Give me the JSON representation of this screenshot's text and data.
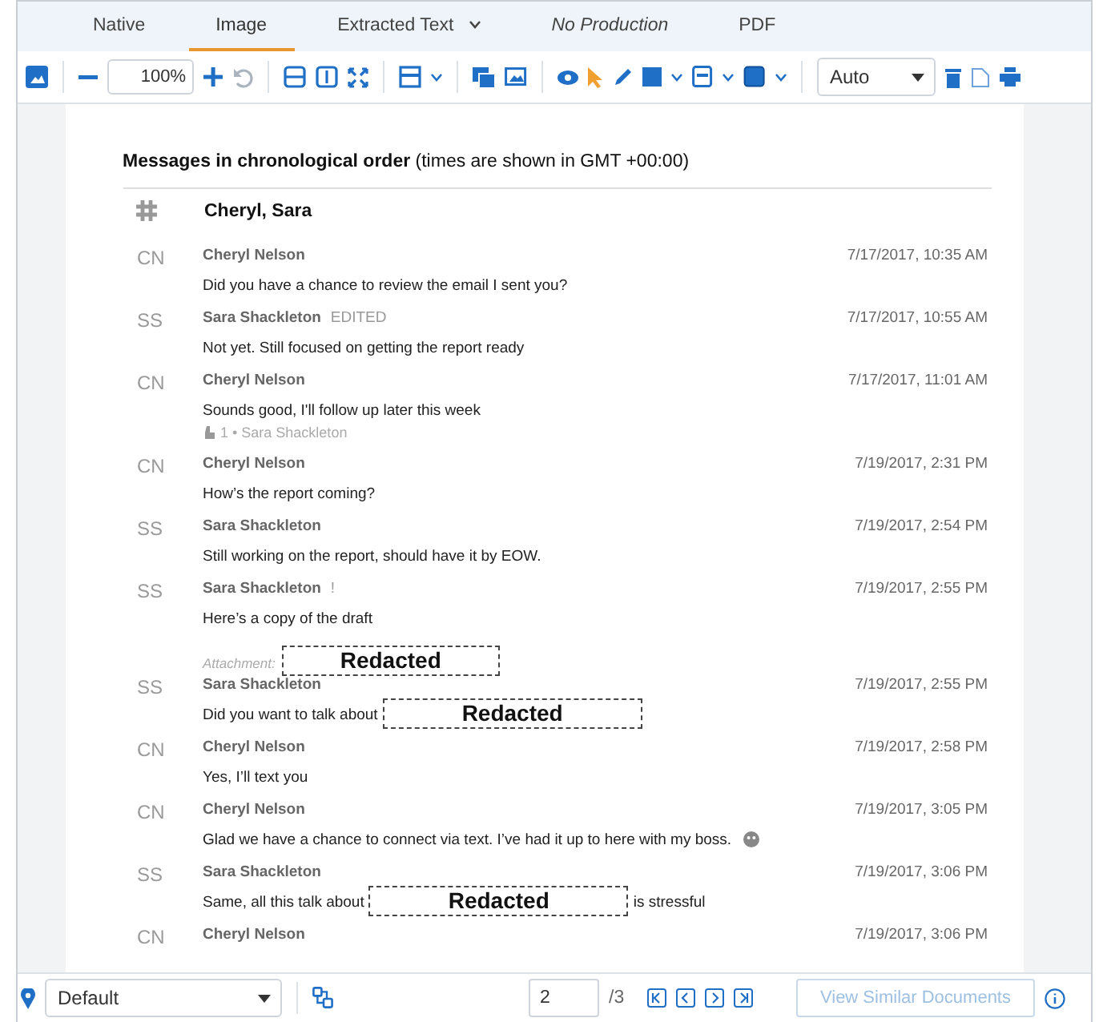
{
  "tabs": [
    {
      "label": "Native",
      "selected": false,
      "disabled": false,
      "dropdown": false
    },
    {
      "label": "Image",
      "selected": true,
      "disabled": false,
      "dropdown": false
    },
    {
      "label": "Extracted Text",
      "selected": false,
      "disabled": false,
      "dropdown": true
    },
    {
      "label": "No Production",
      "selected": false,
      "disabled": true,
      "dropdown": false
    },
    {
      "label": "PDF",
      "selected": false,
      "disabled": false,
      "dropdown": false
    }
  ],
  "toolbar": {
    "zoom": "100%",
    "redaction_mode": "Auto"
  },
  "document": {
    "heading": {
      "title": "Messages in chronological order",
      "note": "(times are shown in GMT +00:00)"
    },
    "conversation": "Cheryl, Sara",
    "messages": [
      {
        "initials": "CN",
        "author": "Cheryl Nelson",
        "time": "7/17/2017, 10:35 AM",
        "body": [
          {
            "kind": "text",
            "text": "Did you have a chance to review the email I sent you?"
          }
        ]
      },
      {
        "initials": "SS",
        "author": "Sara Shackleton",
        "tag": "EDITED",
        "time": "7/17/2017, 10:55 AM",
        "body": [
          {
            "kind": "text",
            "text": "Not yet. Still focused on getting the report ready"
          }
        ]
      },
      {
        "initials": "CN",
        "author": "Cheryl Nelson",
        "time": "7/17/2017, 11:01 AM",
        "body": [
          {
            "kind": "text",
            "text": "Sounds good, I'll follow up later this week"
          }
        ],
        "reaction": "1 • Sara Shackleton"
      },
      {
        "initials": "CN",
        "author": "Cheryl Nelson",
        "time": "7/19/2017, 2:31 PM",
        "body": [
          {
            "kind": "text",
            "text": "How’s the report coming?"
          }
        ]
      },
      {
        "initials": "SS",
        "author": "Sara Shackleton",
        "time": "7/19/2017, 2:54 PM",
        "body": [
          {
            "kind": "text",
            "text": "Still working on the report, should have it by EOW."
          }
        ]
      },
      {
        "initials": "SS",
        "author": "Sara Shackleton",
        "tag": "!",
        "time": "7/19/2017, 2:55 PM",
        "body": [
          {
            "kind": "text",
            "text": "Here’s a copy of the draft"
          }
        ],
        "attachment": {
          "label": "Attachment:",
          "redaction": "Redacted"
        }
      },
      {
        "initials": "SS",
        "author": "Sara Shackleton",
        "time": "7/19/2017, 2:55 PM",
        "body": [
          {
            "kind": "text",
            "text": "Did you want to talk about"
          },
          {
            "kind": "redaction",
            "text": "Redacted"
          }
        ]
      },
      {
        "initials": "CN",
        "author": "Cheryl Nelson",
        "time": "7/19/2017, 2:58 PM",
        "body": [
          {
            "kind": "text",
            "text": "Yes, I’ll text you"
          }
        ]
      },
      {
        "initials": "CN",
        "author": "Cheryl Nelson",
        "time": "7/19/2017, 3:05 PM",
        "body": [
          {
            "kind": "text",
            "text": "Glad we have a chance to connect via text. I’ve had it up to here with my boss."
          },
          {
            "kind": "emoji"
          }
        ]
      },
      {
        "initials": "SS",
        "author": "Sara Shackleton",
        "time": "7/19/2017, 3:06 PM",
        "body": [
          {
            "kind": "text",
            "text": "Same, all this talk about"
          },
          {
            "kind": "redaction",
            "text": "Redacted"
          },
          {
            "kind": "text",
            "text": "is stressful"
          }
        ]
      },
      {
        "initials": "CN",
        "author": "Cheryl Nelson",
        "time": "7/19/2017, 3:06 PM"
      }
    ]
  },
  "footer": {
    "markup_set": "Default",
    "page": "2",
    "page_total": "/3",
    "similar_button": "View Similar Documents"
  }
}
